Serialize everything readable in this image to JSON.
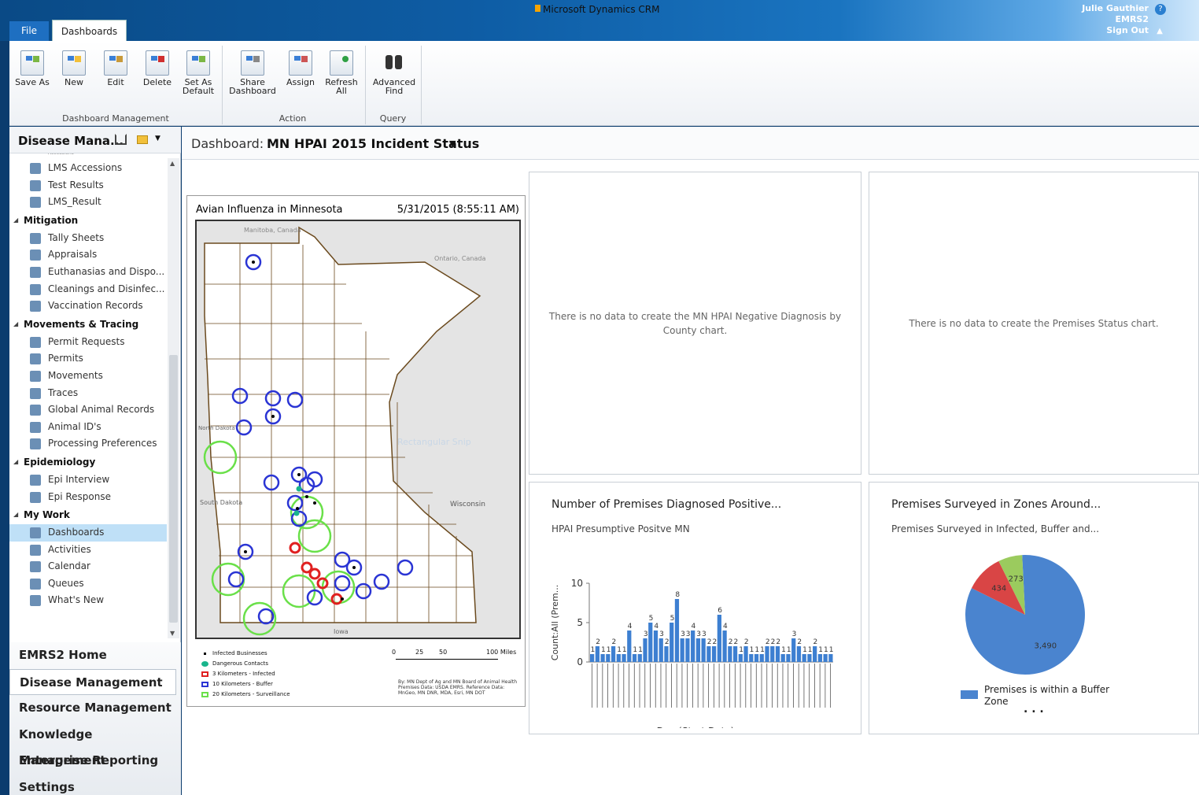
{
  "app": {
    "title": "Microsoft Dynamics CRM"
  },
  "user": {
    "name": "Julie Gauthier",
    "org": "EMRS2",
    "signout": "Sign Out",
    "help": "?"
  },
  "tabs": {
    "file": "File",
    "dashboards": "Dashboards"
  },
  "ribbon": {
    "buttons": [
      {
        "label": "Save As",
        "icon": "save-as-icon"
      },
      {
        "label": "New",
        "icon": "new-dashboard-icon"
      },
      {
        "label": "Edit",
        "icon": "edit-icon"
      },
      {
        "label": "Delete",
        "icon": "delete-icon"
      },
      {
        "label": "Set As Default",
        "icon": "set-default-icon"
      },
      {
        "label": "Share Dashboard",
        "icon": "share-icon"
      },
      {
        "label": "Assign",
        "icon": "assign-icon"
      },
      {
        "label": "Refresh All",
        "icon": "refresh-icon"
      },
      {
        "label": "Advanced Find",
        "icon": "binoculars-icon"
      }
    ],
    "groups": [
      "Dashboard Management",
      "Action",
      "Query"
    ]
  },
  "nav": {
    "title": "Disease Mana...",
    "partial_item": "Accessions",
    "items_top": [
      "LMS Accessions",
      "Test Results",
      "LMS_Result"
    ],
    "groups": [
      {
        "name": "Mitigation",
        "items": [
          "Tally Sheets",
          "Appraisals",
          "Euthanasias and Dispo...",
          "Cleanings and Disinfec...",
          "Vaccination Records"
        ]
      },
      {
        "name": "Movements & Tracing",
        "items": [
          "Permit Requests",
          "Permits",
          "Movements",
          "Traces",
          "Global Animal Records",
          "Animal ID's",
          "Processing Preferences"
        ]
      },
      {
        "name": "Epidemiology",
        "items": [
          "Epi Interview",
          "Epi Response"
        ]
      },
      {
        "name": "My Work",
        "items": [
          "Dashboards",
          "Activities",
          "Calendar",
          "Queues",
          "What's New"
        ]
      }
    ],
    "selected": "Dashboards",
    "workplaces": [
      "EMRS2 Home",
      "Disease Management",
      "Resource Management",
      "Knowledge Management",
      "Enterprise Reporting",
      "Settings"
    ],
    "selected_workplace": "Disease Management"
  },
  "dashboard": {
    "label": "Dashboard:",
    "name": "MN HPAI 2015 Incident Status"
  },
  "map": {
    "title": "Avian Influenza in Minnesota",
    "date": "5/31/2015 (8:55:11 AM)",
    "labels": {
      "manitoba": "Manitoba, Canada",
      "ontario": "Ontario, Canada",
      "north_dakota": "North Dakota",
      "south_dakota": "South Dakota",
      "wisconsin": "Wisconsin",
      "iowa": "Iowa",
      "watermark": "Rectangular Snip"
    },
    "legend": [
      "Infected Businesses",
      "Dangerous Contacts",
      "3 Kilometers - Infected",
      "10 Kilometers - Buffer",
      "20 Kilometers - Surveillance"
    ],
    "legend_colors": [
      "#000000",
      "#19b58c",
      "#e02020",
      "#2a34d4",
      "#6ae049"
    ],
    "scale": [
      "0",
      "25",
      "50",
      "100 Miles"
    ],
    "credits": "By: MN Dept of Ag and MN Board of Animal Health Premises Data: USDA EMRS. Reference Data: MnGeo, MN DNR, MDA, Esri, MN DOT"
  },
  "panels": {
    "negative": "There is no data to create the MN HPAI Negative Diagnosis by County chart.",
    "premises_status": "There is no data to create the Premises Status chart.",
    "positive": {
      "title": "Number of Premises Diagnosed Positive...",
      "subtitle": "HPAI Presumptive Positve MN"
    },
    "surveyed": {
      "title": "Premises Surveyed in Zones Around...",
      "subtitle": "Premises Surveyed in Infected, Buffer and...",
      "legend_line1": "Premises is within a Buffer",
      "legend_line2": "Zone",
      "more": ". . ."
    }
  },
  "chart_data": [
    {
      "type": "bar",
      "title": "Number of Premises Diagnosed Positive...",
      "subtitle": "HPAI Presumptive Positve MN",
      "xlabel": "Day (Start Date)",
      "ylabel": "Count:All (Prem...",
      "ylim": [
        0,
        10
      ],
      "yticks": [
        0,
        5,
        10
      ],
      "values": [
        1,
        2,
        1,
        1,
        2,
        1,
        1,
        4,
        1,
        1,
        3,
        5,
        4,
        3,
        2,
        5,
        8,
        3,
        3,
        4,
        3,
        3,
        2,
        2,
        6,
        4,
        2,
        2,
        1,
        2,
        1,
        1,
        1,
        2,
        2,
        2,
        1,
        1,
        3,
        2,
        1,
        1,
        2,
        1,
        1,
        1
      ],
      "labels_visible": [
        "1",
        "2",
        "1",
        "1",
        "2",
        "1",
        "1",
        "4",
        "1",
        "1",
        "3",
        "5",
        "4",
        "3",
        "2",
        "5",
        "8",
        "3",
        "3",
        "4",
        "3",
        "3",
        "2",
        "2",
        "6",
        "4",
        "2",
        "2",
        "1",
        "2",
        "1",
        "1",
        "1",
        "2",
        "2",
        "2",
        "1",
        "1",
        "3",
        "2",
        "1",
        "1",
        "2",
        "1",
        "1",
        "1"
      ],
      "color": "#3d7fd1"
    },
    {
      "type": "pie",
      "title": "Premises Surveyed in Zones Around...",
      "subtitle": "Premises Surveyed in Infected, Buffer and...",
      "slices": [
        {
          "label": "3,490",
          "value": 3490,
          "color": "#4a84cf"
        },
        {
          "label": "434",
          "value": 434,
          "color": "#d94545"
        },
        {
          "label": "273",
          "value": 273,
          "color": "#9bcb5e"
        }
      ],
      "legend": [
        "Premises is within a Buffer Zone"
      ]
    }
  ]
}
